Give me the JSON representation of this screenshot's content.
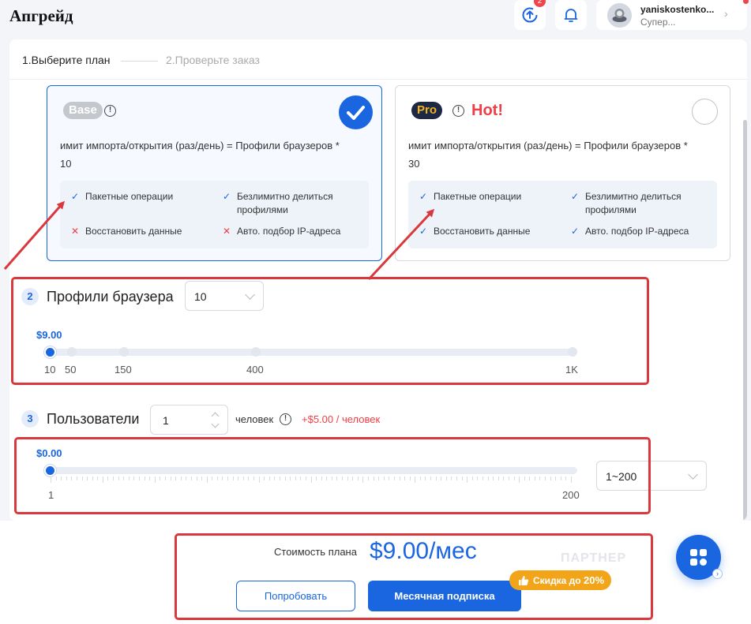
{
  "page": {
    "title": "Апгрейд"
  },
  "header": {
    "sync_badge": "2",
    "user": {
      "name": "yaniskostenko...",
      "role": "Супер..."
    }
  },
  "steps": [
    {
      "label": "1.Выберите план"
    },
    {
      "label": "2.Проверьте заказ"
    }
  ],
  "plans": [
    {
      "name": "Base",
      "description": "имит импорта/открытия (раз/день) = Профили браузеров *",
      "multiplier": "10",
      "selected": true,
      "features": [
        {
          "label": "Пакетные операции",
          "included": true
        },
        {
          "label": "Безлимитно делиться профилями",
          "included": true
        },
        {
          "label": "Восстановить данные",
          "included": false
        },
        {
          "label": "Авто. подбор IP-адреса",
          "included": false
        }
      ]
    },
    {
      "name": "Pro",
      "tag": "Hot!",
      "description": "имит импорта/открытия (раз/день) = Профили браузеров *",
      "multiplier": "30",
      "selected": false,
      "features": [
        {
          "label": "Пакетные операции",
          "included": true
        },
        {
          "label": "Безлимитно делиться профилями",
          "included": true
        },
        {
          "label": "Восстановить данные",
          "included": true
        },
        {
          "label": "Авто. подбор IP-адреса",
          "included": true
        }
      ]
    }
  ],
  "profiles": {
    "step": "2",
    "title": "Профили браузера",
    "select_value": "10",
    "price": "$9.00",
    "slider_ticks": [
      "10",
      "50",
      "150",
      "400",
      "1K"
    ],
    "selected_index": 0
  },
  "users": {
    "step": "3",
    "title": "Пользователи",
    "count": "1",
    "unit_label": "человек",
    "price_per_user": "+$5.00 / человек",
    "price": "$0.00",
    "slider_min": "1",
    "slider_max": "200",
    "range_select": "1~200",
    "value": 1
  },
  "footer": {
    "cost_label": "Стоимость плана",
    "cost_value": "$9.00/мес",
    "try_button": "Попробовать",
    "subscribe_button": "Месячная подписка",
    "discount_prefix": "Скидка до",
    "discount_value": "20%",
    "watermark": "ПАРТНЕР"
  },
  "colors": {
    "accent": "#1a66e0",
    "danger": "#ef3e45",
    "annotation": "#d9393c",
    "discount": "#f3a51a"
  },
  "icons": [
    "sync-icon",
    "bell-icon",
    "info-icon",
    "check-icon",
    "cross-icon",
    "thumbs-up-icon",
    "apps-icon",
    "chevron-down-icon"
  ]
}
